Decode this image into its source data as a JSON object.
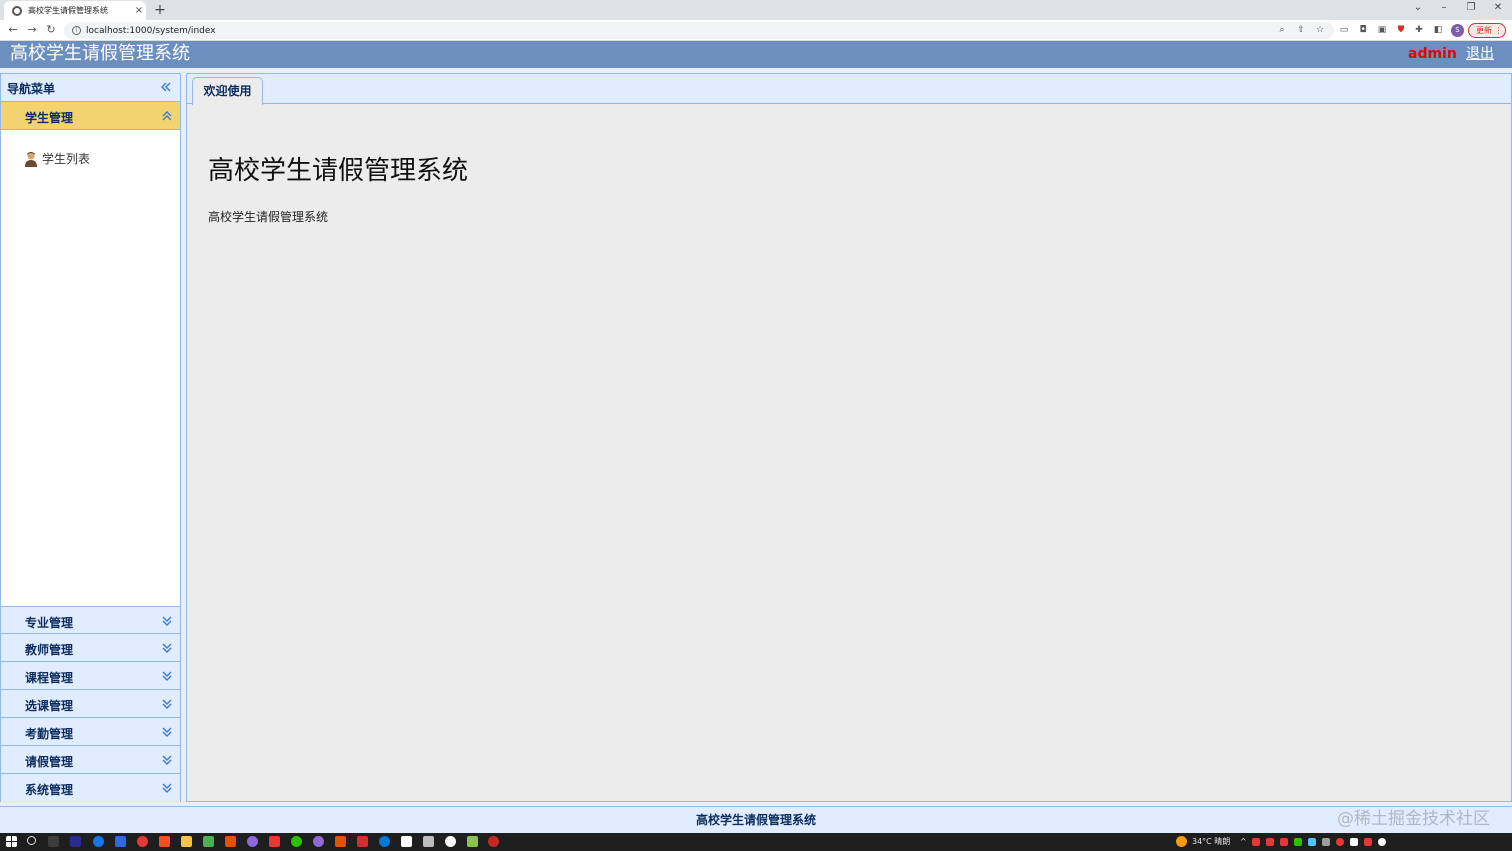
{
  "browser": {
    "tab_title": "高校学生请假管理系统",
    "tab_close": "×",
    "new_tab": "+",
    "url": "localhost:1000/system/index",
    "update_label": "更新",
    "profile_initial": "S"
  },
  "header": {
    "title": "高校学生请假管理系统",
    "username": "admin",
    "logout": "退出"
  },
  "sidebar": {
    "title": "导航菜单",
    "sections": [
      {
        "label": "学生管理",
        "expanded": true,
        "items": [
          {
            "label": "学生列表",
            "icon": "person-icon"
          }
        ]
      },
      {
        "label": "专业管理",
        "expanded": false
      },
      {
        "label": "教师管理",
        "expanded": false
      },
      {
        "label": "课程管理",
        "expanded": false
      },
      {
        "label": "选课管理",
        "expanded": false
      },
      {
        "label": "考勤管理",
        "expanded": false
      },
      {
        "label": "请假管理",
        "expanded": false
      },
      {
        "label": "系统管理",
        "expanded": false
      }
    ]
  },
  "main": {
    "tab_label": "欢迎使用",
    "heading": "高校学生请假管理系统",
    "text": "高校学生请假管理系统"
  },
  "footer": {
    "text": "高校学生请假管理系统",
    "watermark": "@稀土掘金技术社区"
  },
  "taskbar": {
    "weather": "34°C 晴朗"
  },
  "colors": {
    "header_bg": "#6d8fbf",
    "panel_header": "#e0ecff",
    "active_section": "#f3d36e",
    "username": "#e8000b",
    "nav_text": "#0e2d5f"
  }
}
